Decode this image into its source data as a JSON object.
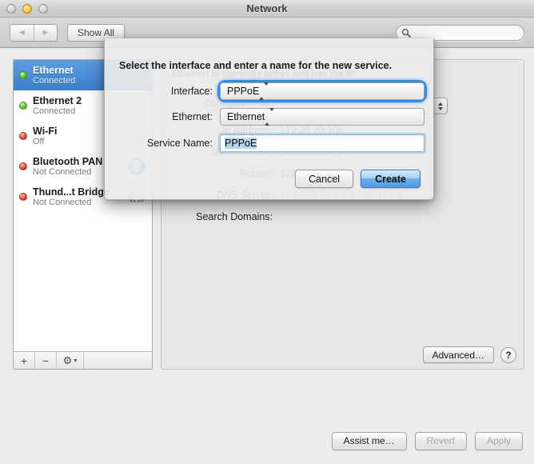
{
  "window": {
    "title": "Network",
    "traffic_lights": [
      "close-button",
      "minimize-button",
      "zoom-button"
    ]
  },
  "toolbar": {
    "back_icon": "◀",
    "forward_icon": "▶",
    "show_all_label": "Show All",
    "search": {
      "placeholder": "",
      "value": "",
      "icon": "search-icon"
    }
  },
  "sidebar": {
    "services": [
      {
        "name": "Ethernet",
        "status": "Connected",
        "dot": "green",
        "selected": true,
        "icon": ""
      },
      {
        "name": "Ethernet 2",
        "status": "Connected",
        "dot": "green",
        "selected": false,
        "icon": ""
      },
      {
        "name": "Wi-Fi",
        "status": "Off",
        "dot": "red",
        "selected": false,
        "icon": "wifi-icon"
      },
      {
        "name": "Bluetooth PAN",
        "status": "Not Connected",
        "dot": "red",
        "selected": false,
        "icon": "bluetooth-icon"
      },
      {
        "name": "Thund...t Bridge",
        "status": "Not Connected",
        "dot": "red",
        "selected": false,
        "icon": "thunderbolt-bridge-icon"
      }
    ],
    "toolbar": {
      "add_label": "+",
      "remove_label": "−",
      "gear_label": "⚙",
      "gear_arrow": "▾"
    }
  },
  "main": {
    "status_text": "Ethernet is currently active and has the IP",
    "configure_label": "Configure IPv4:",
    "configure_value": "",
    "fields": [
      {
        "label": "IP Address:",
        "value": "172.20.20.106",
        "dim": false
      },
      {
        "label": "Subnet Mask:",
        "value": "255.255.255.0",
        "dim": false
      },
      {
        "label": "Router:",
        "value": "172.20.20.254",
        "dim": false
      },
      {
        "label": "DNS Server:",
        "value": "193.150.34.1, 91.230.181.1",
        "dim": true
      },
      {
        "label": "Search Domains:",
        "value": "",
        "dim": false
      }
    ],
    "advanced_label": "Advanced…",
    "help_label": "?"
  },
  "bottom": {
    "assist_label": "Assist me…",
    "revert_label": "Revert",
    "apply_label": "Apply"
  },
  "sheet": {
    "message": "Select the interface and enter a name for the new service.",
    "interface_label": "Interface:",
    "interface_value": "PPPoE",
    "ethernet_label": "Ethernet:",
    "ethernet_value": "Ethernet",
    "service_name_label": "Service Name:",
    "service_name_value": "PPPoE",
    "service_name_placeholder": "",
    "cancel_label": "Cancel",
    "create_label": "Create"
  },
  "colors": {
    "selection_blue": "#3b7fcc",
    "focus_ring_blue": "#288cf0",
    "default_button_blue": "#4f9ae6",
    "status_green": "#5ec637",
    "status_red": "#e24b33",
    "bluetooth_blue": "#1d8ef0"
  }
}
